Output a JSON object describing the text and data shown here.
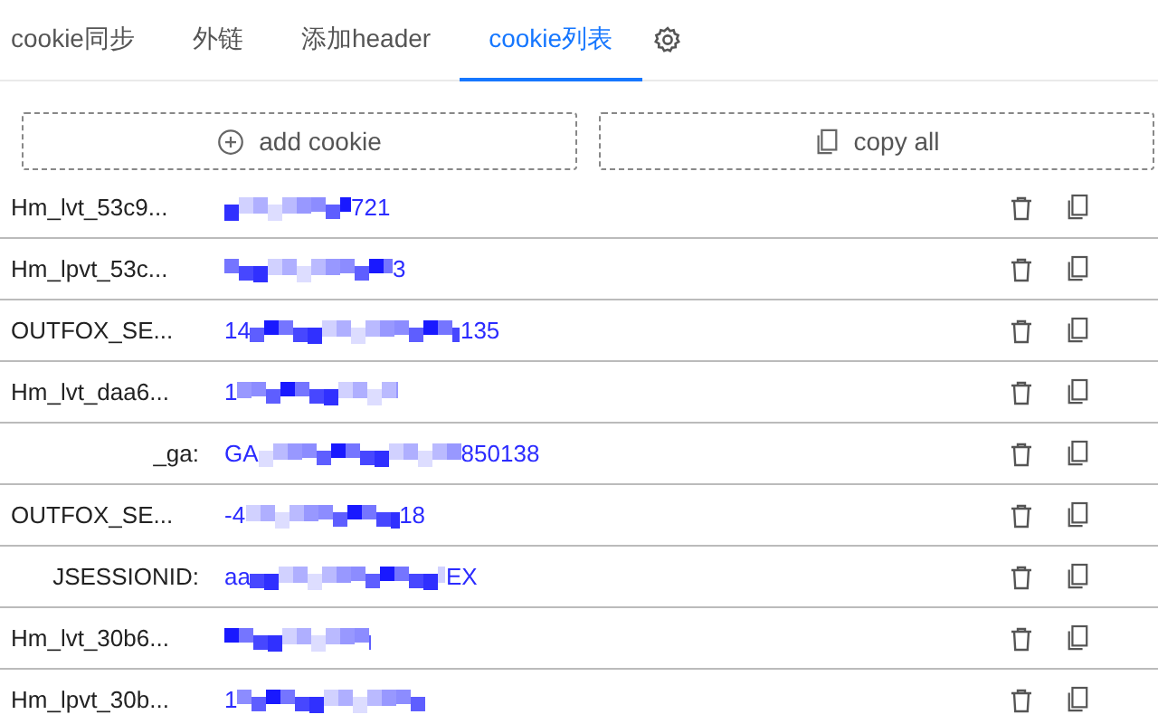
{
  "tabs": [
    {
      "label": "cookie同步",
      "selected": false
    },
    {
      "label": "外链",
      "selected": false
    },
    {
      "label": "添加header",
      "selected": false
    },
    {
      "label": "cookie列表",
      "selected": true
    }
  ],
  "actions": [
    {
      "kind": "add",
      "label": "add cookie"
    },
    {
      "kind": "copy",
      "label": "copy all"
    }
  ],
  "cookies": [
    {
      "name": "Hm_lvt_53c9...",
      "value_end": "721"
    },
    {
      "name": "Hm_lpvt_53c...",
      "value_end": "3"
    },
    {
      "name": "OUTFOX_SE...",
      "value_start": "14",
      "value_end": "135"
    },
    {
      "name": "Hm_lvt_daa6...",
      "value_start": "1"
    },
    {
      "name": "_ga:",
      "value_start": "GA",
      "value_end": "850138"
    },
    {
      "name": "OUTFOX_SE...",
      "value_start": "-4",
      "value_end": "18"
    },
    {
      "name": "JSESSIONID:",
      "value_start": "aa",
      "value_end": "EX"
    },
    {
      "name": "Hm_lvt_30b6..."
    },
    {
      "name": "Hm_lpvt_30b...",
      "value_start": "1"
    }
  ]
}
